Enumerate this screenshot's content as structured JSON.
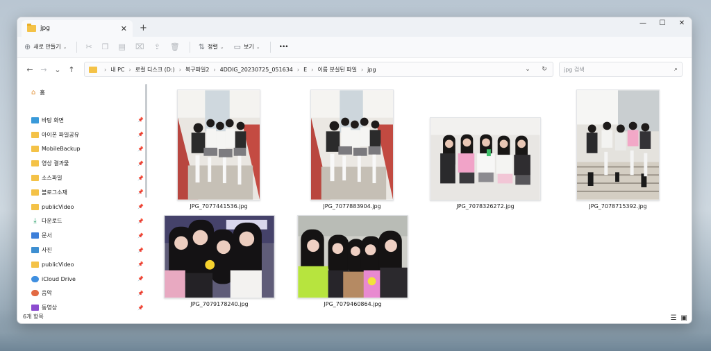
{
  "window": {
    "tab_title": "jpg",
    "tab_close": "✕",
    "new_tab": "+",
    "controls": {
      "minimize": "—",
      "maximize": "☐",
      "close": "✕"
    }
  },
  "toolbar": {
    "new_label": "새로 만들기",
    "sort_label": "정렬",
    "view_label": "보기",
    "more_label": "•••"
  },
  "address": {
    "crumbs": [
      "내 PC",
      "로컬 디스크 (D:)",
      "복구파일2",
      "4DDIG_20230725_051634",
      "E",
      "이름 분실된 파일",
      "jpg"
    ],
    "search_placeholder": "jpg 검색"
  },
  "sidebar": {
    "home": "홈",
    "items": [
      {
        "label": "바탕 화면",
        "icon": "desktop-icon"
      },
      {
        "label": "아이폰 파일공유",
        "icon": "folder-icon"
      },
      {
        "label": "MobileBackup",
        "icon": "folder-icon"
      },
      {
        "label": "영상 결과물",
        "icon": "folder-icon"
      },
      {
        "label": "소스파일",
        "icon": "folder-icon"
      },
      {
        "label": "블로그소재",
        "icon": "folder-icon"
      },
      {
        "label": "publicVideo",
        "icon": "folder-icon"
      },
      {
        "label": "다운로드",
        "icon": "download-icon"
      },
      {
        "label": "문서",
        "icon": "document-icon"
      },
      {
        "label": "사진",
        "icon": "pictures-icon"
      },
      {
        "label": "publicVideo",
        "icon": "folder-icon"
      },
      {
        "label": "iCloud Drive",
        "icon": "icloud-icon"
      },
      {
        "label": "음악",
        "icon": "music-icon"
      },
      {
        "label": "동영상",
        "icon": "video-icon"
      }
    ]
  },
  "files": [
    {
      "name": "JPG_7077441536.jpg"
    },
    {
      "name": "JPG_7077883904.jpg"
    },
    {
      "name": "JPG_7078326272.jpg"
    },
    {
      "name": "JPG_7078715392.jpg"
    },
    {
      "name": "JPG_7079178240.jpg"
    },
    {
      "name": "JPG_7079460864.jpg"
    }
  ],
  "status": {
    "item_count": "6개 항목"
  }
}
